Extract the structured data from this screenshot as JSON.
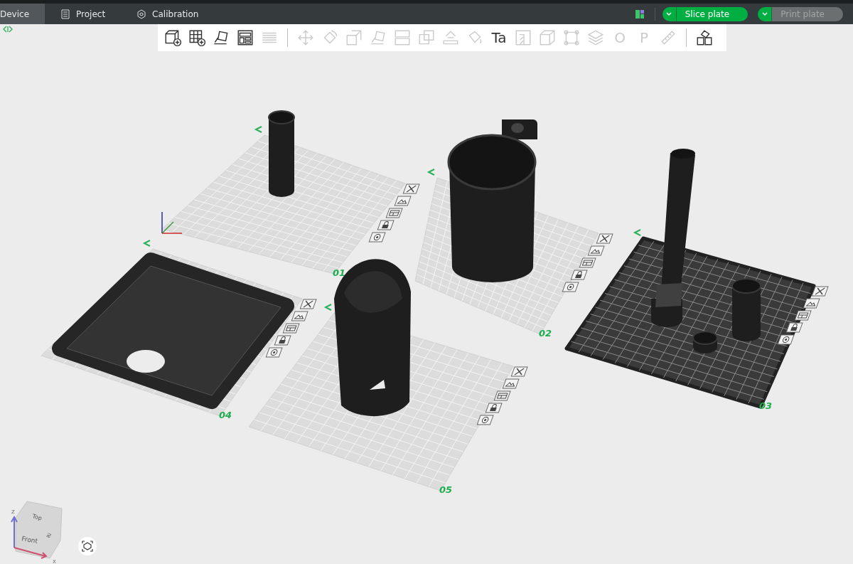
{
  "tabs": [
    {
      "label": "Device",
      "selected": true
    },
    {
      "label": "Project",
      "selected": false
    },
    {
      "label": "Calibration",
      "selected": false
    }
  ],
  "slice_button": {
    "label": "Slice plate",
    "disabled": false
  },
  "print_button": {
    "label": "Print plate",
    "disabled": true
  },
  "toolbar": [
    {
      "kind": "tool",
      "disabled": false
    },
    {
      "kind": "tool",
      "disabled": false
    },
    {
      "kind": "tool",
      "disabled": false
    },
    {
      "kind": "tool",
      "disabled": false
    },
    {
      "kind": "tool",
      "disabled": true
    },
    {
      "kind": "separator"
    },
    {
      "kind": "tool",
      "disabled": true
    },
    {
      "kind": "tool",
      "disabled": true
    },
    {
      "kind": "tool",
      "disabled": true
    },
    {
      "kind": "tool",
      "disabled": true
    },
    {
      "kind": "tool",
      "disabled": true
    },
    {
      "kind": "tool",
      "disabled": true
    },
    {
      "kind": "tool",
      "disabled": true
    },
    {
      "kind": "tool",
      "disabled": true
    },
    {
      "kind": "tool",
      "disabled": false,
      "glyph": "Ta"
    },
    {
      "kind": "tool",
      "disabled": true
    },
    {
      "kind": "tool",
      "disabled": true
    },
    {
      "kind": "tool",
      "disabled": true
    },
    {
      "kind": "tool",
      "disabled": true
    },
    {
      "kind": "tool",
      "disabled": true,
      "glyph": "O"
    },
    {
      "kind": "tool",
      "disabled": true,
      "glyph": "P"
    },
    {
      "kind": "tool",
      "disabled": true
    },
    {
      "kind": "separator"
    },
    {
      "kind": "tool",
      "disabled": false
    }
  ],
  "plates": [
    {
      "label": "01",
      "selected": false
    },
    {
      "label": "02",
      "selected": false
    },
    {
      "label": "03",
      "selected": true
    },
    {
      "label": "04",
      "selected": false
    },
    {
      "label": "05",
      "selected": false
    }
  ],
  "view_cube": {
    "faces": [
      "Top",
      "Front",
      "Ri"
    ],
    "axes": [
      "Z",
      "X"
    ]
  }
}
